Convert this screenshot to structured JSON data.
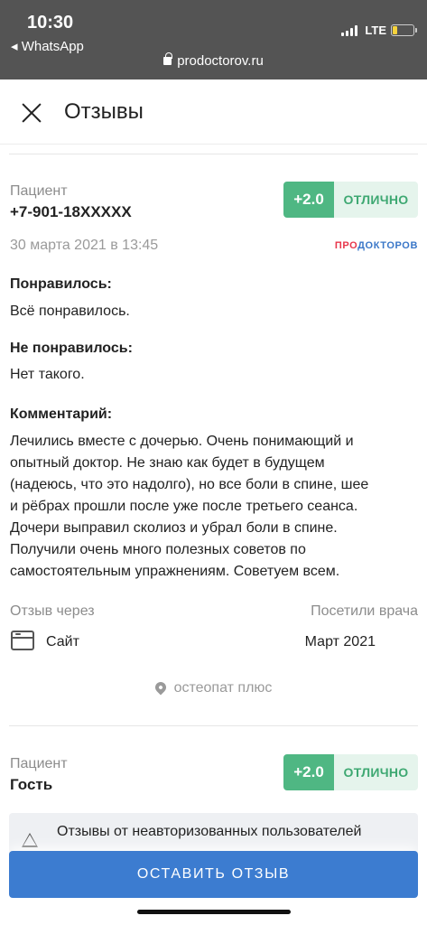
{
  "status_bar": {
    "time": "10:30",
    "back_app": "◂ WhatsApp",
    "url": "prodoctorov.ru",
    "network": "LTE"
  },
  "header": {
    "title": "Отзывы"
  },
  "review1": {
    "author_label": "Пациент",
    "author": "+7-901-18XXXXX",
    "score": "+2.0",
    "grade": "ОТЛИЧНО",
    "date": "30 марта 2021 в 13:45",
    "logo_part1": "ПРО",
    "logo_part2": "ДОКТОРОВ",
    "liked_title": "Понравилось:",
    "liked_text": "Всё понравилось.",
    "disliked_title": "Не понравилось:",
    "disliked_text": "Нет такого.",
    "comment_title": "Комментарий:",
    "comment_lines": [
      "Лечились вместе с дочерью. Очень понимающий и",
      "опытный доктор. Не знаю как будет в будущем",
      "(надеюсь, что это надолго), но все боли в спине, шее",
      "и рёбрах прошли после уже после третьего сеанса.",
      "Дочери выправил сколиоз и убрал боли в спине.",
      "Получили очень много полезных советов по",
      "самостоятельным упражнениям. Советуем всем."
    ],
    "via_label": "Отзыв через",
    "via_value": "Сайт",
    "visit_label": "Посетили врача",
    "visit_value": "Март 2021",
    "clinic": "остеопат плюс"
  },
  "review2": {
    "author_label": "Пациент",
    "author": "Гость",
    "score": "+2.0",
    "grade": "ОТЛИЧНО",
    "notice": "Отзывы от неавторизованных пользователей"
  },
  "cta": {
    "label": "ОСТАВИТЬ ОТЗЫВ"
  },
  "colors": {
    "accent": "#3c7cd0",
    "rating_green": "#4fb783",
    "logo_red": "#e8364b",
    "logo_blue": "#3a77c8"
  }
}
